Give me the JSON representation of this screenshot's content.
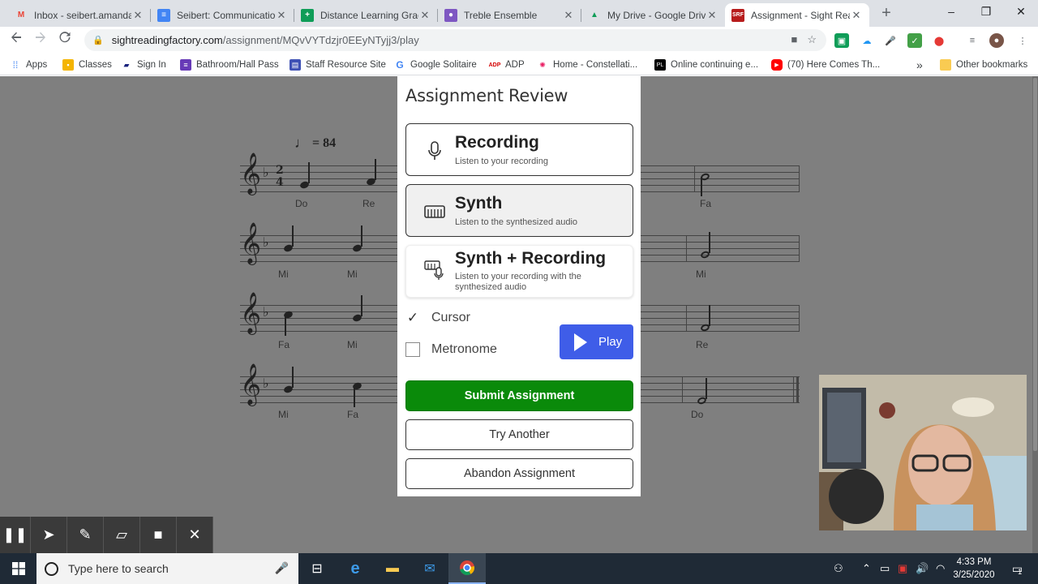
{
  "browser": {
    "tabs": [
      {
        "title": "Inbox - seibert.amanda",
        "icon": "gmail-icon",
        "color": "#ea4335",
        "glyph": "M"
      },
      {
        "title": "Seibert: Communication",
        "icon": "docs-icon",
        "color": "#4285f4",
        "glyph": "≡"
      },
      {
        "title": "Distance Learning Grad",
        "icon": "sheets-icon",
        "color": "#0f9d58",
        "glyph": "+"
      },
      {
        "title": "Treble Ensemble",
        "icon": "classroom-icon",
        "color": "#7e57c2",
        "glyph": "●"
      },
      {
        "title": "My Drive - Google Drive",
        "icon": "drive-icon",
        "color": "#f4b400",
        "glyph": "▲"
      },
      {
        "title": "Assignment - Sight Rea",
        "icon": "sightreading-icon",
        "color": "#b71c1c",
        "glyph": "SRF",
        "active": true
      }
    ],
    "new_tab": "+",
    "window_controls": {
      "minimize": "–",
      "maximize": "❐",
      "close": "✕"
    },
    "omnibox": {
      "host": "sightreadingfactory.com",
      "path": "/assignment/MQvVYTdzjr0EEyNTyjj3/play"
    },
    "bookmarks": [
      {
        "label": "Apps",
        "icon": "apps-grid-icon",
        "color": "#4285f4"
      },
      {
        "label": "Classes",
        "icon": "classroom-icon",
        "color": "#f4b400"
      },
      {
        "label": "Sign In",
        "icon": "graduation-cap-icon",
        "color": "#1a237e"
      },
      {
        "label": "Bathroom/Hall Pass",
        "icon": "form-icon",
        "color": "#673ab7"
      },
      {
        "label": "Staff Resource Site",
        "icon": "sites-icon",
        "color": "#3f51b5"
      },
      {
        "label": "Google Solitaire",
        "icon": "google-g-icon",
        "color": "#4285f4"
      },
      {
        "label": "ADP",
        "icon": "adp-icon",
        "color": "#d50000"
      },
      {
        "label": "Home - Constellati...",
        "icon": "constellation-icon",
        "color": "#e91e63"
      },
      {
        "label": "Online continuing e...",
        "icon": "pl-icon",
        "color": "#000000"
      },
      {
        "label": "(70) Here Comes Th...",
        "icon": "youtube-icon",
        "color": "#ff0000"
      }
    ],
    "bookmarks_overflow": "»",
    "other_bookmarks": "Other bookmarks"
  },
  "sheet": {
    "tempo": "= 84",
    "rows": [
      {
        "left": [
          "Do",
          "Re"
        ],
        "right": "Fa"
      },
      {
        "left": [
          "Mi",
          "Mi"
        ],
        "right": "Mi"
      },
      {
        "left": [
          "Fa",
          "Mi"
        ],
        "right": "Re"
      },
      {
        "left": [
          "Mi",
          "Fa"
        ],
        "right": "Do"
      }
    ]
  },
  "dialog": {
    "title": "Assignment Review",
    "modes": [
      {
        "title": "Recording",
        "subtitle": "Listen to your recording"
      },
      {
        "title": "Synth",
        "subtitle": "Listen to the synthesized audio"
      },
      {
        "title": "Synth + Recording",
        "subtitle": "Listen to your recording with the synthesized audio"
      }
    ],
    "cursor_label": "Cursor",
    "cursor_checked": true,
    "metronome_label": "Metronome",
    "metronome_checked": false,
    "play_label": "Play",
    "submit_label": "Submit Assignment",
    "try_another_label": "Try Another",
    "abandon_label": "Abandon Assignment"
  },
  "taskbar": {
    "search_placeholder": "Type here to search",
    "time": "4:33 PM",
    "date": "3/25/2020",
    "notifications_count": "1"
  },
  "colors": {
    "play_button": "#3f5de8",
    "submit_button": "#0a8a0a",
    "content_background": "#7f7f7f"
  }
}
